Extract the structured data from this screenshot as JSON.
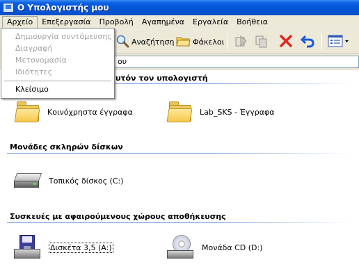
{
  "window": {
    "title": "Ο Υπολογιστής μου"
  },
  "menubar": {
    "items": [
      {
        "label": "Αρχείο"
      },
      {
        "label": "Επεξεργασία"
      },
      {
        "label": "Προβολή"
      },
      {
        "label": "Αγαπημένα"
      },
      {
        "label": "Εργαλεία"
      },
      {
        "label": "Βοήθεια"
      }
    ]
  },
  "file_menu": {
    "items": [
      {
        "label": "Δημιουργία συντόμευσης",
        "disabled": true
      },
      {
        "label": "Διαγραφή",
        "disabled": true
      },
      {
        "label": "Μετονομασία",
        "disabled": true
      },
      {
        "label": "Ιδιότητες",
        "disabled": true
      },
      {
        "label": "Κλείσιμο",
        "disabled": false
      }
    ]
  },
  "toolbar": {
    "search_label": "Αναζήτηση",
    "folders_label": "Φάκελοι"
  },
  "address": {
    "value": "ου"
  },
  "groups": {
    "stored_files_header_fragment": "υτόν τον υπολογιστή",
    "hard_disks_header": "Μονάδες σκληρών δίσκων",
    "removable_header": "Συσκευές με αφαιρούμενους χώρους αποθήκευσης"
  },
  "items": {
    "shared_docs": "Κοινόχρηστα έγγραφα",
    "lab_docs": "Lab_SKS - Έγγραφα",
    "local_disk": "Τοπικός δίσκος (C:)",
    "floppy": "Δισκέτα 3,5 (A:)",
    "cd_drive": "Μονάδα CD (D:)"
  },
  "colors": {
    "titlebar": "#0254d8",
    "chrome": "#ece9d8",
    "group_line": "#7aa1e6",
    "delete_red": "#e0261f",
    "undo_blue": "#1f5ad8"
  }
}
